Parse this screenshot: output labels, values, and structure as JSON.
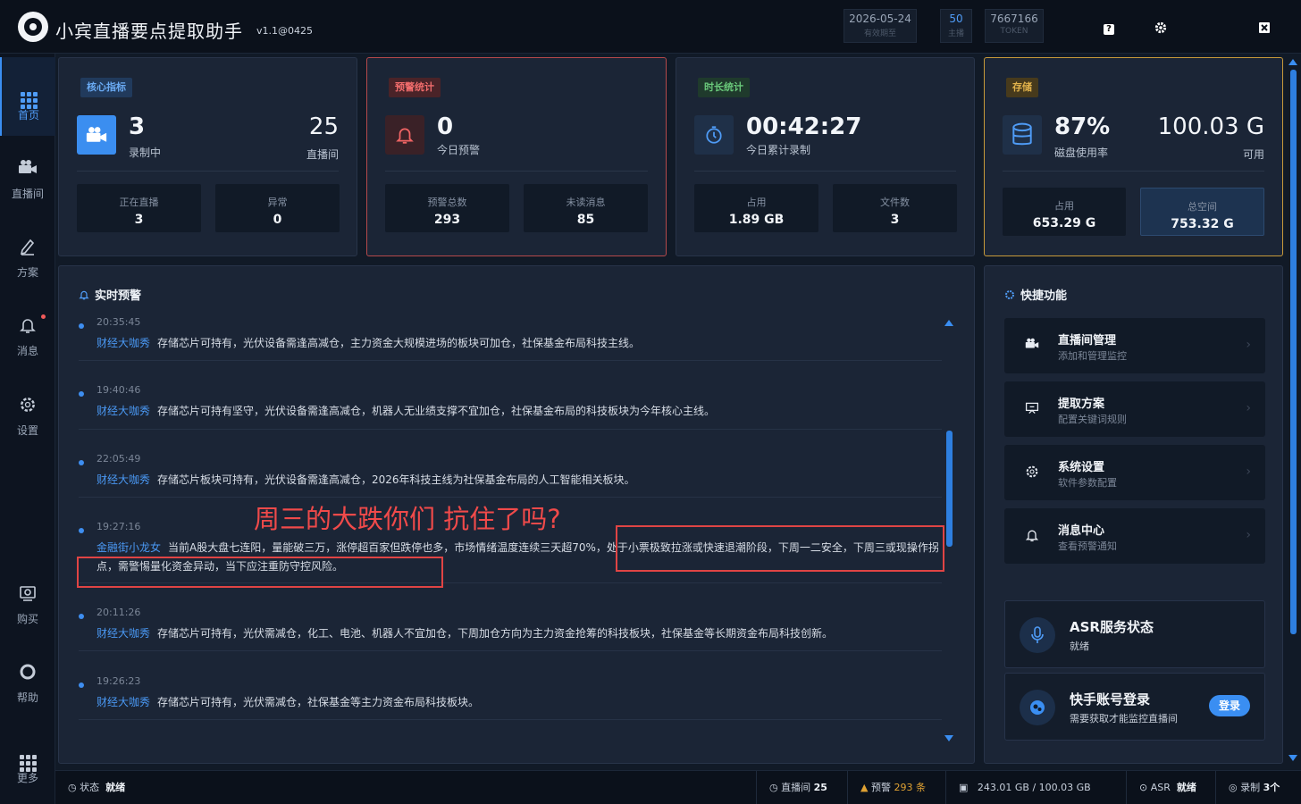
{
  "app": {
    "title": "小宾直播要点提取助手",
    "version": "v1.1@0425"
  },
  "titlebar": {
    "expiry": {
      "value": "2026-05-24",
      "label": "有效期至"
    },
    "hosts": {
      "value": "50",
      "label": "主播"
    },
    "token": {
      "value": "7667166",
      "label": "TOKEN"
    }
  },
  "sidebar": [
    {
      "label": "首页",
      "icon": "grid-icon"
    },
    {
      "label": "直播间",
      "icon": "camera-icon"
    },
    {
      "label": "方案",
      "icon": "pen-icon"
    },
    {
      "label": "消息",
      "icon": "bell-icon"
    },
    {
      "label": "设置",
      "icon": "gear-icon"
    },
    {
      "label": "购买",
      "icon": "cart-icon"
    },
    {
      "label": "帮助",
      "icon": "help-icon"
    },
    {
      "label": "更多",
      "icon": "more-grid-icon"
    }
  ],
  "cards": {
    "core": {
      "tag": "核心指标",
      "value": "3",
      "label": "录制中",
      "right_value": "25",
      "right_label": "直播间",
      "mini": [
        {
          "label": "正在直播",
          "value": "3"
        },
        {
          "label": "异常",
          "value": "0"
        }
      ]
    },
    "alert": {
      "tag": "预警统计",
      "value": "0",
      "label": "今日预警",
      "mini": [
        {
          "label": "预警总数",
          "value": "293"
        },
        {
          "label": "未读消息",
          "value": "85"
        }
      ]
    },
    "duration": {
      "tag": "时长统计",
      "value": "00:42:27",
      "label": "今日累计录制",
      "mini": [
        {
          "label": "占用",
          "value": "1.89 GB"
        },
        {
          "label": "文件数",
          "value": "3"
        }
      ]
    },
    "storage": {
      "tag": "存储",
      "value": "87%",
      "label": "磁盘使用率",
      "right_value": "100.03 G",
      "right_label": "可用",
      "mini": [
        {
          "label": "占用",
          "value": "653.29 G"
        },
        {
          "label": "总空间",
          "value": "753.32 G"
        }
      ]
    }
  },
  "alerts_panel": {
    "title": "实时预警",
    "items": [
      {
        "time": "20:35:45",
        "source": "财经大咖秀",
        "text": "存储芯片可持有，光伏设备需逢高减仓，主力资金大规模进场的板块可加仓，社保基金布局科技主线。"
      },
      {
        "time": "19:40:46",
        "source": "财经大咖秀",
        "text": "存储芯片可持有坚守，光伏设备需逢高减仓，机器人无业绩支撑不宜加仓，社保基金布局的科技板块为今年核心主线。"
      },
      {
        "time": "22:05:49",
        "source": "财经大咖秀",
        "text": "存储芯片板块可持有，光伏设备需逢高减仓，2026年科技主线为社保基金布局的人工智能相关板块。"
      },
      {
        "time": "19:27:16",
        "source": "金融街小龙女",
        "text": "当前A股大盘七连阳，量能破三万，涨停超百家但跌停也多，市场情绪温度连续三天超70%，处于小票极致拉涨或快速退潮阶段，下周一二安全，下周三或现操作拐点，需警惕量化资金异动，当下应注重防守控风险。"
      },
      {
        "time": "20:11:26",
        "source": "财经大咖秀",
        "text": "存储芯片可持有，光伏需减仓，化工、电池、机器人不宜加仓，下周加仓方向为主力资金抢筹的科技板块，社保基金等长期资金布局科技创新。"
      },
      {
        "time": "19:26:23",
        "source": "财经大咖秀",
        "text": "存储芯片可持有，光伏需减仓，社保基金等主力资金布局科技板块。"
      }
    ],
    "overlay_text": "周三的大跌你们 抗住了吗?"
  },
  "quick": {
    "title": "快捷功能",
    "items": [
      {
        "title": "直播间管理",
        "desc": "添加和管理监控",
        "icon": "camera-icon"
      },
      {
        "title": "提取方案",
        "desc": "配置关键词规则",
        "icon": "board-icon"
      },
      {
        "title": "系统设置",
        "desc": "软件参数配置",
        "icon": "gear-icon"
      },
      {
        "title": "消息中心",
        "desc": "查看预警通知",
        "icon": "bell-icon"
      }
    ],
    "asr": {
      "title": "ASR服务状态",
      "status": "就绪"
    },
    "kuaishou": {
      "title": "快手账号登录",
      "desc": "需要获取才能监控直播间",
      "button": "登录"
    }
  },
  "statusbar": {
    "state_label": "状态",
    "state_value": "就绪",
    "rooms_label": "直播间",
    "rooms_value": "25",
    "warn_label": "预警",
    "warn_value": "293 条",
    "disk": "243.01 GB / 100.03 GB",
    "asr_label": "ASR",
    "asr_value": "就绪",
    "rec_label": "录制",
    "rec_value": "3个"
  },
  "colors": {
    "accent": "#3a8ef2",
    "alert_red": "#b5494b",
    "storage_gold": "#c89a3a",
    "annotation_red": "#e04444"
  }
}
